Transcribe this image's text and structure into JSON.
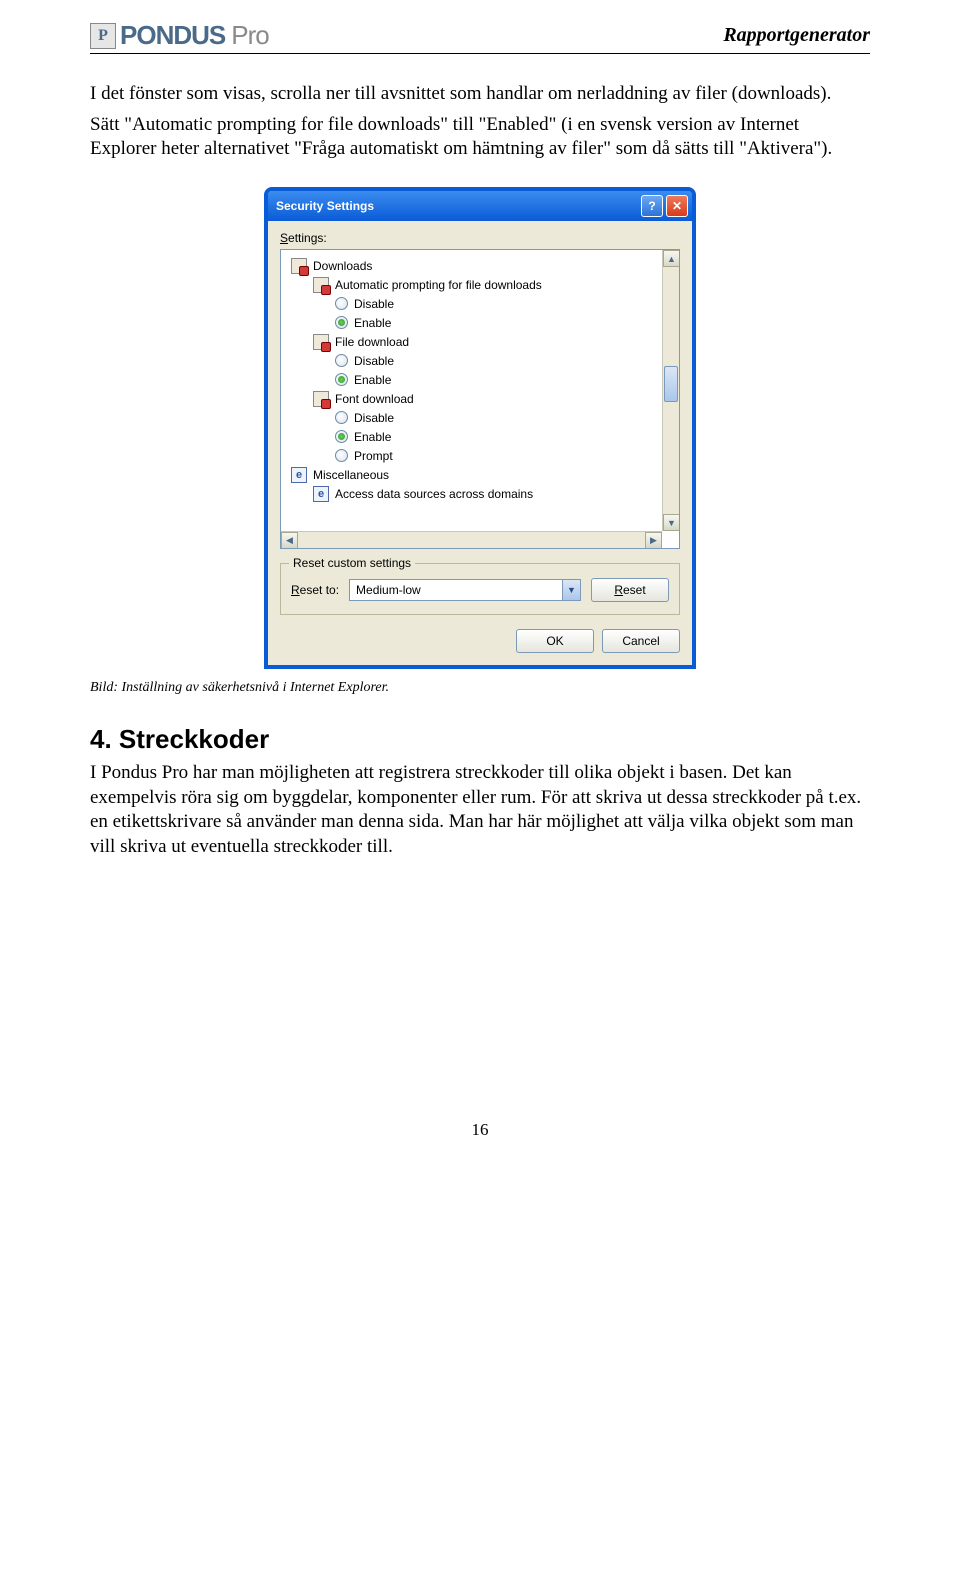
{
  "header": {
    "logo_name": "PONDUS",
    "logo_suffix": "Pro",
    "doc_title": "Rapportgenerator"
  },
  "para1": "I det fönster som visas, scrolla ner till avsnittet som handlar om nerladdning av filer (downloads).",
  "para2": "Sätt \"Automatic prompting for file downloads\" till \"Enabled\" (i en svensk version av Internet Explorer heter alternativet \"Fråga automatiskt om hämtning av filer\" som då sätts till \"Aktivera\").",
  "dialog": {
    "title": "Security Settings",
    "settings_label": "Settings:",
    "tree": {
      "cat_downloads": "Downloads",
      "opt_auto_prompt": "Automatic prompting for file downloads",
      "opt_disable": "Disable",
      "opt_enable": "Enable",
      "opt_file_download": "File download",
      "opt_font_download": "Font download",
      "opt_prompt": "Prompt",
      "cat_misc": "Miscellaneous",
      "opt_access_data": "Access data sources across domains"
    },
    "reset_group": "Reset custom settings",
    "reset_to_label": "Reset to:",
    "reset_combo_value": "Medium-low",
    "reset_btn": "Reset",
    "ok": "OK",
    "cancel": "Cancel"
  },
  "caption": "Bild: Inställning av säkerhetsnivå i Internet Explorer.",
  "section4_num": "4.",
  "section4_title": "Streckkoder",
  "section4_body": "I Pondus Pro har man möjligheten att registrera streckkoder till olika objekt i basen. Det kan exempelvis röra sig om byggdelar, komponenter eller rum. För att skriva ut dessa streckkoder på t.ex. en etikettskrivare så använder man denna sida. Man har här möjlighet att välja vilka objekt som man vill skriva ut eventuella streckkoder till.",
  "page_number": "16"
}
